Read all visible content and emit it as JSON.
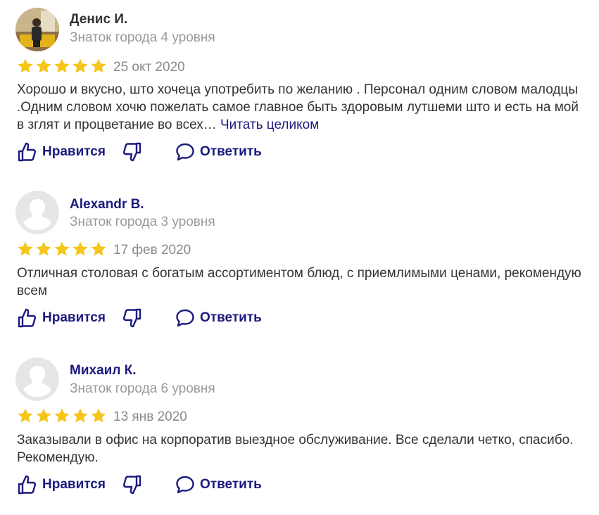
{
  "actions": {
    "like_label": "Нравится",
    "reply_label": "Ответить"
  },
  "colors": {
    "star": "#f5c518",
    "link": "#1a1a7e",
    "muted": "#9a9a9a",
    "text": "#333333"
  },
  "icons": {
    "like": "thumbs-up-icon",
    "dislike": "thumbs-down-icon",
    "reply": "speech-bubble-icon",
    "star": "star-icon"
  },
  "reviews": [
    {
      "author": "Денис И.",
      "level": "Знаток города 4 уровня",
      "rating": 5,
      "date": "25 окт 2020",
      "text": "Хорошо и вкусно, што хочеца употребить по желанию . Персонал одним словом малодцы .Одним словом хочю пожелать самое главное быть здоровым лутшеми што и есть на мой в зглят и процветание во всех…",
      "read_more": "Читать целиком"
    },
    {
      "author": "Alexandr B.",
      "level": "Знаток города 3 уровня",
      "rating": 5,
      "date": "17 фев 2020",
      "text": "Отличная столовая с богатым ассортиментом блюд, с приемлимыми ценами, рекомендую всем"
    },
    {
      "author": "Михаил К.",
      "level": "Знаток города 6 уровня",
      "rating": 5,
      "date": "13 янв 2020",
      "text": "Заказывали в офис на корпоратив выездное обслуживание. Все сделали четко, спасибо. Рекомендую."
    }
  ]
}
